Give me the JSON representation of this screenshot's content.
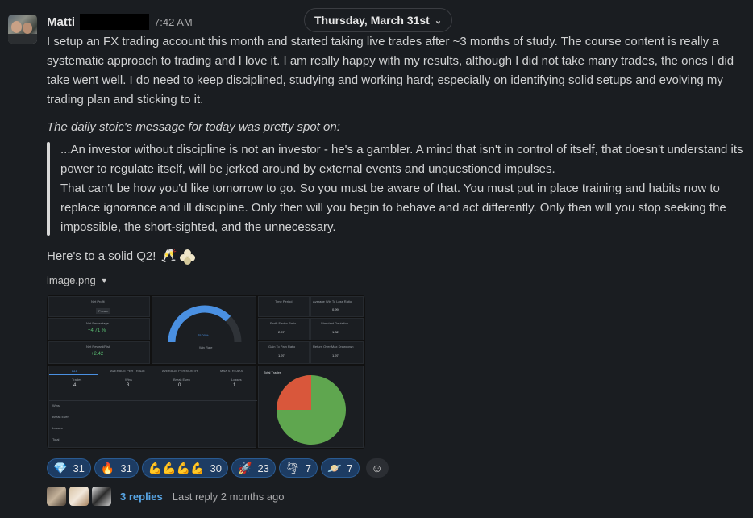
{
  "date_divider": {
    "label": "Thursday, March 31st",
    "icon": "chevron-down-icon"
  },
  "message": {
    "author": "Matti",
    "time": "7:42 AM",
    "body": "I setup an FX trading account this month and started taking live trades after ~3 months of study.  The course content is really a systematic approach to trading and I love it.  I am really happy with my results, although I did not take many trades, the ones I did take went well.  I do need to keep disciplined, studying and working hard; especially on identifying solid setups and evolving my trading plan and sticking to it.",
    "italic_line": "The daily stoic's message for today was pretty spot on:",
    "quote_line1": "...An investor without discipline is not an investor - he's a gambler.  A mind that isn't in control of itself, that doesn't understand its power to regulate itself, will be jerked around by external events and unquestioned impulses.",
    "quote_line2": "That can't be how you'd like tomorrow to go.  So you must be aware of that.  You must put in place training and habits now to replace ignorance and ill discipline.  Only then will you begin to behave and act differently.  Only then will you stop seeking the impossible, the short-sighted, and the unnecessary.",
    "cheer": "Here's to a solid Q2!"
  },
  "attachment": {
    "filename": "image.png",
    "dashboard": {
      "net_profit": "Net Profit",
      "net_percentage": "Net Percentage",
      "net_percentage_value": "+4.71 %",
      "net_reward_risk": "Net Reward/Risk",
      "net_reward_risk_value": "+2.42",
      "win_rate_value": "75.00%",
      "win_rate_label": "Win Rate",
      "time_period": "Time Period",
      "avg_win_loss": "Average Win To Loss Ratio",
      "avg_win_loss_value": "0.99",
      "profit_factor": "Profit Factor Ratio",
      "profit_factor_value": "2.97",
      "std_dev": "Standard Deviation",
      "std_dev_value": "1.32",
      "gain_pain": "Gain To Pain Ratio",
      "gain_pain_value": "1.97",
      "return_dd": "Return Over Max Drawdown",
      "return_dd_value": "1.97",
      "tabs": [
        "ALL",
        "AVERAGE PER TRADE",
        "AVERAGE PER MONTH",
        "MAX STREAKS"
      ],
      "trades_label": "Trades",
      "trades_value": "4",
      "wins_label": "Wins",
      "wins_value": "3",
      "breakeven_label": "Break Even",
      "breakeven_value": "0",
      "losses_label": "Losses",
      "losses_value": "1",
      "row_labels": [
        "Wins",
        "Break Even",
        "Losses",
        "Total"
      ],
      "pie_title": "Total Trades",
      "win_fraction": 0.75
    }
  },
  "reactions": [
    {
      "icon": "gem-icon",
      "glyph": "💎",
      "count": "31"
    },
    {
      "icon": "fire-icon",
      "glyph": "🔥",
      "count": "31"
    },
    {
      "icon": "flexed-biceps-icon",
      "glyph": "💪💪💪💪",
      "count": "30"
    },
    {
      "icon": "rocket-icon",
      "glyph": "🚀",
      "count": "23"
    },
    {
      "icon": "tornado-icon",
      "glyph": "🌪",
      "count": "7"
    },
    {
      "icon": "saturn-icon",
      "glyph": "🪐",
      "count": "7"
    }
  ],
  "add_reaction_icon": "add-reaction-icon",
  "thread": {
    "replies": "3 replies",
    "last_reply": "Last reply 2 months ago"
  },
  "colors": {
    "background": "#1a1d21",
    "link": "#58a6e6",
    "reaction_bg": "#1d3c63",
    "gauge": "#4a90e2",
    "pie_win": "#5fa64f",
    "pie_loss": "#d9573b"
  }
}
